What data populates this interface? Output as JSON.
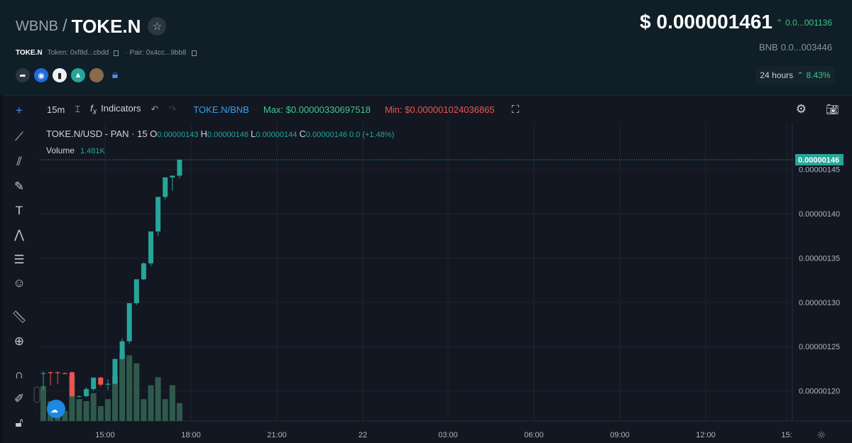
{
  "header": {
    "base": "WBNB",
    "slash": "/",
    "quote": "TOKE.N",
    "symbol": "TOKE.N",
    "token_label": "Token: 0xf8d...cbdd",
    "pair_label": "· Pair: 0x4cc...9bb8",
    "price": "$ 0.000001461",
    "price_change": "0.0...001136",
    "bnb_label": "BNB",
    "bnb_value": "0.0...003446",
    "period_label": "24 hours",
    "period_change": "8.43%",
    "icons": [
      "share-icon",
      "coinmarketcap-icon",
      "chart-site-icon",
      "dex-icon",
      "token-logo-icon",
      "lock-icon"
    ]
  },
  "toolbar": {
    "interval": "15m",
    "indicators": "Indicators",
    "pair": "TOKE.N/BNB",
    "max": "Max: $0.00000330697518",
    "min": "Min: $0.000001024036865"
  },
  "legend": {
    "title": "TOKE.N/USD - PAN · 15",
    "o_label": "O",
    "o_value": "0.00000143",
    "h_label": "H",
    "h_value": "0.00000146",
    "l_label": "L",
    "l_value": "0.00000144",
    "c_label": "C",
    "c_value": "0.00000146",
    "change": "0.0 (+1.48%)",
    "volume_label": "Volume",
    "volume_value": "1.481K"
  },
  "colors": {
    "up": "#26a69a",
    "down": "#ef5350",
    "volume": "#2e5a4c",
    "accent": "#4b8bf5"
  },
  "chart_data": {
    "type": "candlestick",
    "ylim": [
      1.166e-06,
      1.469e-06
    ],
    "last_price_label": "0.00000146",
    "y_ticks": [
      {
        "v": 1.45e-06,
        "label": "0.00000145"
      },
      {
        "v": 1.4e-06,
        "label": "0.00000140"
      },
      {
        "v": 1.35e-06,
        "label": "0.00000135"
      },
      {
        "v": 1.3e-06,
        "label": "0.00000130"
      },
      {
        "v": 1.25e-06,
        "label": "0.00000125"
      },
      {
        "v": 1.2e-06,
        "label": "0.00000120"
      }
    ],
    "x_ticks": [
      "15:00",
      "18:00",
      "21:00",
      "22",
      "03:00",
      "06:00",
      "09:00",
      "12:00",
      "15:"
    ],
    "candles": [
      {
        "o": 1.22e-06,
        "h": 1.222e-06,
        "l": 1.201e-06,
        "c": 1.22e-06,
        "v": 0.0
      },
      {
        "o": 1.221e-06,
        "h": 1.222e-06,
        "l": 1.206e-06,
        "c": 1.22e-06,
        "v": 0.0
      },
      {
        "o": 1.221e-06,
        "h": 1.222e-06,
        "l": 1.208e-06,
        "c": 1.22e-06,
        "v": 0.0
      },
      {
        "o": 1.22e-06,
        "h": 1.221e-06,
        "l": 1.219e-06,
        "c": 1.219e-06,
        "v": 0.0
      },
      {
        "o": 1.221e-06,
        "h": 1.222e-06,
        "l": 1.193e-06,
        "c": 1.194e-06,
        "v": 0.0
      },
      {
        "o": 1.194e-06,
        "h": 1.195e-06,
        "l": 1.193e-06,
        "c": 1.194e-06,
        "v": 0.0
      },
      {
        "o": 1.194e-06,
        "h": 1.204e-06,
        "l": 1.193e-06,
        "c": 1.202e-06,
        "v": 0.0
      },
      {
        "o": 1.202e-06,
        "h": 1.215e-06,
        "l": 1.2e-06,
        "c": 1.215e-06,
        "v": 0.0
      },
      {
        "o": 1.215e-06,
        "h": 1.216e-06,
        "l": 1.205e-06,
        "c": 1.207e-06,
        "v": 0.0
      },
      {
        "o": 1.207e-06,
        "h": 1.213e-06,
        "l": 1.201e-06,
        "c": 1.208e-06,
        "v": 0.0
      },
      {
        "o": 1.208e-06,
        "h": 1.236e-06,
        "l": 1.207e-06,
        "c": 1.236e-06,
        "v": 0.0
      },
      {
        "o": 1.236e-06,
        "h": 1.259e-06,
        "l": 1.234e-06,
        "c": 1.256e-06,
        "v": 0.0
      },
      {
        "o": 1.256e-06,
        "h": 1.299e-06,
        "l": 1.253e-06,
        "c": 1.299e-06,
        "v": 0.0
      },
      {
        "o": 1.299e-06,
        "h": 1.326e-06,
        "l": 1.297e-06,
        "c": 1.326e-06,
        "v": 0.0
      },
      {
        "o": 1.326e-06,
        "h": 1.345e-06,
        "l": 1.325e-06,
        "c": 1.344e-06,
        "v": 0.0
      },
      {
        "o": 1.344e-06,
        "h": 1.38e-06,
        "l": 1.341e-06,
        "c": 1.38e-06,
        "v": 0.0
      },
      {
        "o": 1.38e-06,
        "h": 1.419e-06,
        "l": 1.375e-06,
        "c": 1.419e-06,
        "v": 0.0
      },
      {
        "o": 1.419e-06,
        "h": 1.441e-06,
        "l": 1.416e-06,
        "c": 1.441e-06,
        "v": 0.0
      },
      {
        "o": 1.441e-06,
        "h": 1.443e-06,
        "l": 1.426e-06,
        "c": 1.443e-06,
        "v": 0.0
      },
      {
        "o": 1.443e-06,
        "h": 1.461e-06,
        "l": 1.44e-06,
        "c": 1.461e-06,
        "v": 1.481
      }
    ],
    "volumes": [
      0.35,
      0.2,
      0.2,
      0.1,
      0.45,
      0.22,
      0.2,
      0.28,
      0.15,
      0.22,
      0.45,
      0.68,
      0.66,
      0.58,
      0.22,
      0.36,
      0.44,
      0.22,
      0.36,
      0.18
    ]
  }
}
